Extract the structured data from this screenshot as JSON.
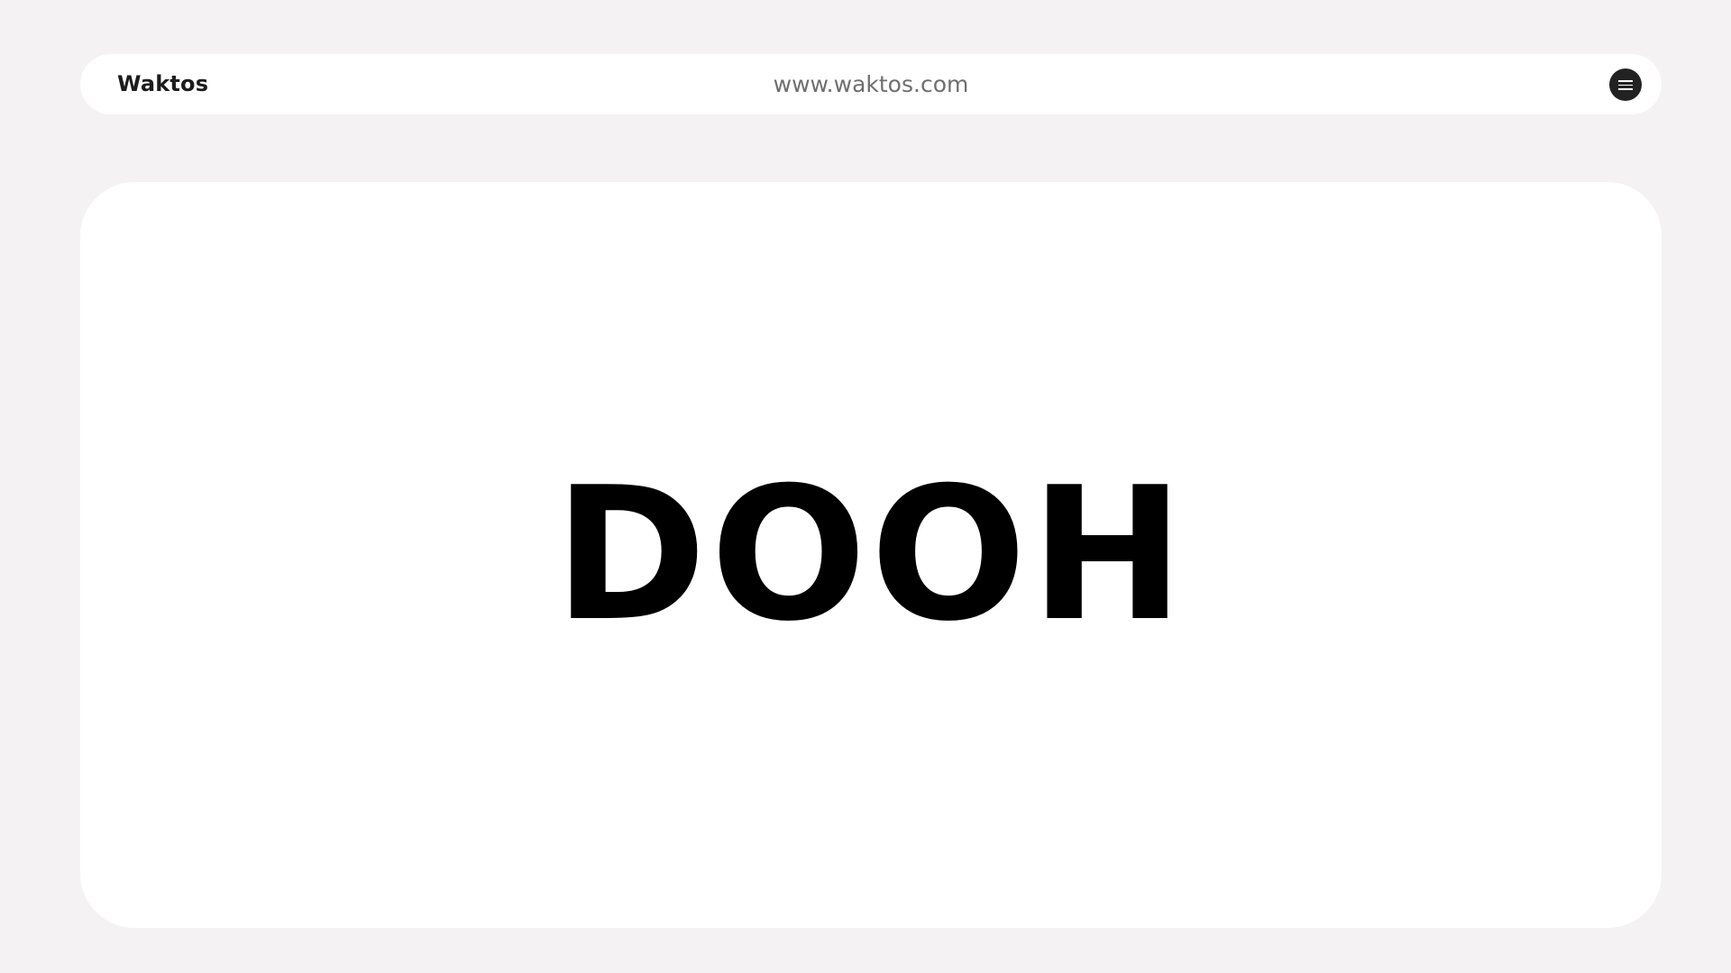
{
  "header": {
    "brand": "Waktos",
    "url": "www.waktos.com",
    "menu_icon": "hamburger-menu-icon"
  },
  "main": {
    "headline": "DOOH"
  },
  "colors": {
    "background": "#f4f2f2",
    "surface": "#ffffff",
    "menu_button": "#222222",
    "headline": "#000000"
  }
}
